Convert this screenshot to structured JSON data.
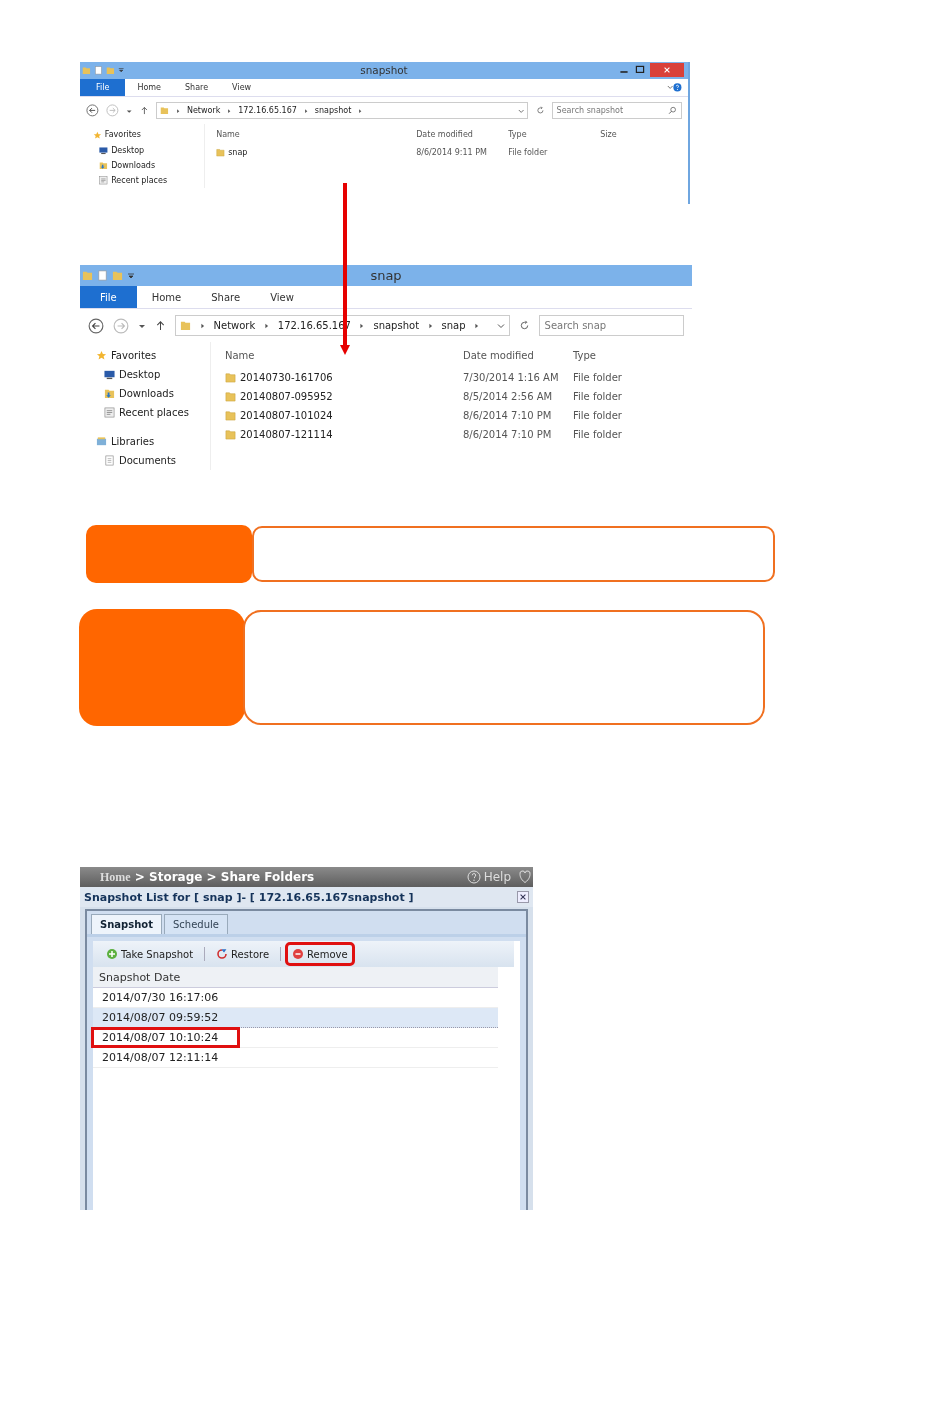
{
  "explorers": [
    {
      "title": "snapshot",
      "window_controls": true,
      "ribbon_help": true,
      "ribbon_tabs": [
        {
          "label": "File",
          "selected": true
        },
        {
          "label": "Home",
          "selected": false
        },
        {
          "label": "Share",
          "selected": false
        },
        {
          "label": "View",
          "selected": false
        }
      ],
      "breadcrumb": [
        "Network",
        "172.16.65.167",
        "snapshot"
      ],
      "search_placeholder": "Search snapshot",
      "columns": [
        "Name",
        "Date modified",
        "Type",
        "Size"
      ],
      "nav": [
        {
          "kind": "favorites",
          "label": "Favorites"
        },
        {
          "kind": "desktop",
          "label": "Desktop"
        },
        {
          "kind": "downloads",
          "label": "Downloads"
        },
        {
          "kind": "recent",
          "label": "Recent places"
        }
      ],
      "rows": [
        {
          "name": "snap",
          "date": "8/6/2014 9:11 PM",
          "type": "File folder"
        }
      ]
    },
    {
      "title": "snap",
      "window_controls": false,
      "ribbon_help": false,
      "ribbon_tabs": [
        {
          "label": "File",
          "selected": true
        },
        {
          "label": "Home",
          "selected": false
        },
        {
          "label": "Share",
          "selected": false
        },
        {
          "label": "View",
          "selected": false
        }
      ],
      "breadcrumb": [
        "Network",
        "172.16.65.167",
        "snapshot",
        "snap"
      ],
      "search_placeholder": "Search snap",
      "columns": [
        "Name",
        "Date modified",
        "Type"
      ],
      "nav": [
        {
          "kind": "favorites",
          "label": "Favorites"
        },
        {
          "kind": "desktop",
          "label": "Desktop"
        },
        {
          "kind": "downloads",
          "label": "Downloads"
        },
        {
          "kind": "recent",
          "label": "Recent places"
        },
        {
          "kind": "libraries",
          "label": "Libraries"
        },
        {
          "kind": "documents",
          "label": "Documents"
        }
      ],
      "rows": [
        {
          "name": "20140730-161706",
          "date": "7/30/2014 1:16 AM",
          "type": "File folder"
        },
        {
          "name": "20140807-095952",
          "date": "8/5/2014 2:56 AM",
          "type": "File folder"
        },
        {
          "name": "20140807-101024",
          "date": "8/6/2014 7:10 PM",
          "type": "File folder"
        },
        {
          "name": "20140807-121114",
          "date": "8/6/2014 7:10 PM",
          "type": "File folder"
        }
      ]
    }
  ],
  "nas": {
    "breadcrumb_home": "Home",
    "breadcrumb_rest": "> Storage > Share Folders",
    "help": "Help",
    "title": "Snapshot List for [ snap ]- [ 172.16.65.167snapshot ]",
    "tabs": [
      {
        "label": "Snapshot",
        "selected": true
      },
      {
        "label": "Schedule",
        "selected": false
      }
    ],
    "toolbar": [
      {
        "kind": "add",
        "label": "Take Snapshot",
        "highlighted": false
      },
      {
        "kind": "restore",
        "label": "Restore",
        "highlighted": false
      },
      {
        "kind": "remove",
        "label": "Remove",
        "highlighted": true
      }
    ],
    "column": "Snapshot Date",
    "rows": [
      {
        "date": "2014/07/30 16:17:06",
        "selected": false,
        "highlighted": false
      },
      {
        "date": "2014/08/07 09:59:52",
        "selected": true,
        "highlighted": false
      },
      {
        "date": "2014/08/07 10:10:24",
        "selected": false,
        "highlighted": true
      },
      {
        "date": "2014/08/07 12:11:14",
        "selected": false,
        "highlighted": false
      }
    ]
  }
}
